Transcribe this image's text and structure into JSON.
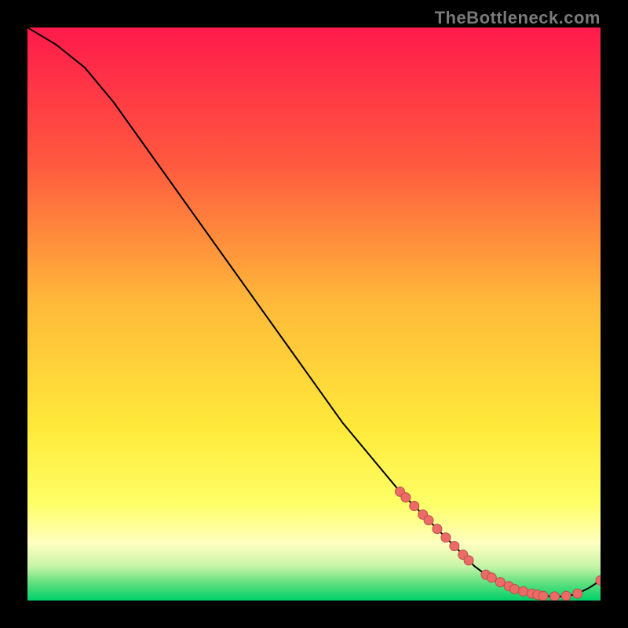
{
  "watermark": "TheBottleneck.com",
  "colors": {
    "black": "#000000",
    "curve": "#000000",
    "marker_fill": "#ec6b66",
    "marker_stroke": "#b8504b",
    "grad_top": "#ff1a4b",
    "grad_mid1": "#ff7a3a",
    "grad_mid2": "#ffd233",
    "grad_yellow": "#ffff4d",
    "grad_pale": "#ffffb3",
    "grad_green1": "#8ef08e",
    "grad_green2": "#00d16a"
  },
  "gradient_stops": [
    {
      "offset": 0.0,
      "color": "#ff1a4b"
    },
    {
      "offset": 0.24,
      "color": "#ff5a3f"
    },
    {
      "offset": 0.48,
      "color": "#ffb93a"
    },
    {
      "offset": 0.7,
      "color": "#ffea3a"
    },
    {
      "offset": 0.83,
      "color": "#ffff66"
    },
    {
      "offset": 0.9,
      "color": "#ffffc0"
    },
    {
      "offset": 0.94,
      "color": "#c8f5a8"
    },
    {
      "offset": 0.97,
      "color": "#5ee07e"
    },
    {
      "offset": 1.0,
      "color": "#00d16a"
    }
  ],
  "chart_data": {
    "type": "line",
    "title": "",
    "xlabel": "",
    "ylabel": "",
    "xlim": [
      0,
      100
    ],
    "ylim": [
      0,
      100
    ],
    "series": [
      {
        "name": "bottleneck-curve",
        "x": [
          0,
          5,
          10,
          15,
          20,
          25,
          30,
          35,
          40,
          45,
          50,
          55,
          60,
          65,
          68,
          70,
          72,
          74,
          76,
          78,
          80,
          82,
          84,
          86,
          88,
          90,
          92,
          94,
          96,
          98,
          100
        ],
        "y": [
          100,
          97,
          93,
          87,
          80,
          73,
          66,
          59,
          52,
          45,
          38,
          31,
          25,
          19,
          16,
          14,
          12,
          10,
          8,
          6,
          4.5,
          3.2,
          2.2,
          1.5,
          1.0,
          0.8,
          0.7,
          0.7,
          1.2,
          2.2,
          3.5
        ]
      }
    ],
    "markers": {
      "name": "highlighted-points",
      "x": [
        65,
        66,
        67.5,
        69,
        70,
        71.5,
        73,
        74.5,
        76,
        77,
        80,
        81,
        82.5,
        84,
        85,
        86.5,
        88,
        89,
        90,
        92,
        94,
        96,
        100
      ],
      "y": [
        19,
        18,
        16.5,
        15,
        14,
        12.5,
        11,
        9.5,
        8,
        7,
        4.5,
        4,
        3.2,
        2.5,
        2,
        1.6,
        1.2,
        1,
        0.8,
        0.7,
        0.8,
        1.2,
        3.5
      ]
    }
  }
}
